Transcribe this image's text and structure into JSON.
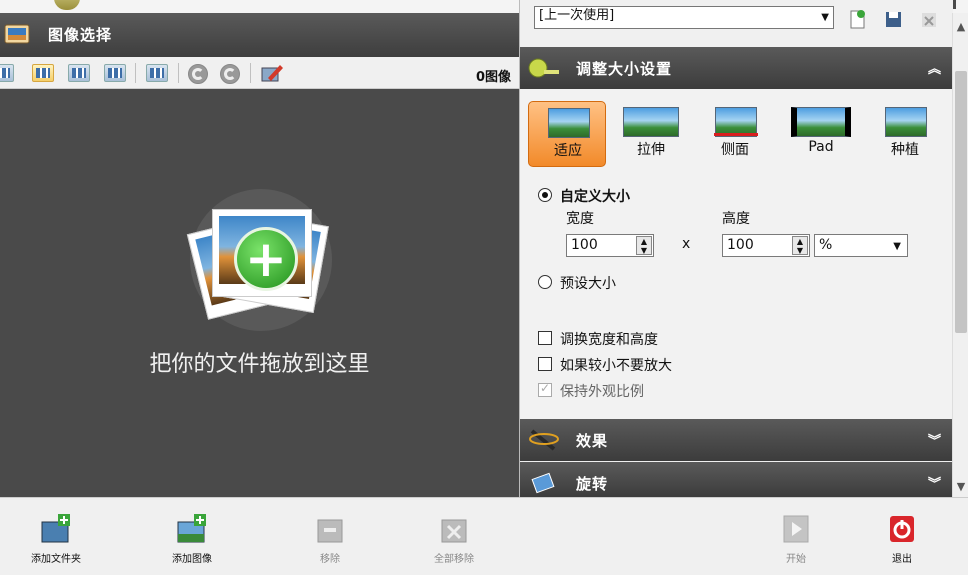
{
  "preset": {
    "value": "[上一次使用]"
  },
  "left_panel": {
    "title": "图像选择",
    "image_count": "0图像",
    "drop_text": "把你的文件拖放到这里"
  },
  "resize": {
    "title": "调整大小设置",
    "modes": [
      {
        "label": "适应",
        "selected": true
      },
      {
        "label": "拉伸",
        "selected": false
      },
      {
        "label": "侧面",
        "selected": false
      },
      {
        "label": "Pad",
        "selected": false
      },
      {
        "label": "种植",
        "selected": false
      }
    ],
    "custom_size_label": "自定义大小",
    "width_label": "宽度",
    "height_label": "高度",
    "width_value": "100",
    "height_value": "100",
    "times": "x",
    "unit": "%",
    "preset_size_label": "预设大小",
    "swap_label": "调换宽度和高度",
    "no_enlarge_label": "如果较小不要放大",
    "keep_aspect_label": "保持外观比例"
  },
  "effects": {
    "title": "效果"
  },
  "rotate": {
    "title": "旋转"
  },
  "bottom": {
    "add_folder": "添加文件夹",
    "add_image": "添加图像",
    "remove": "移除",
    "remove_all": "全部移除",
    "start": "开始",
    "exit": "退出"
  },
  "colors": {
    "accent": "#f28a2a",
    "panel": "#4a4a4a",
    "exit_red": "#d9262b",
    "plus_green": "#2fa324"
  }
}
